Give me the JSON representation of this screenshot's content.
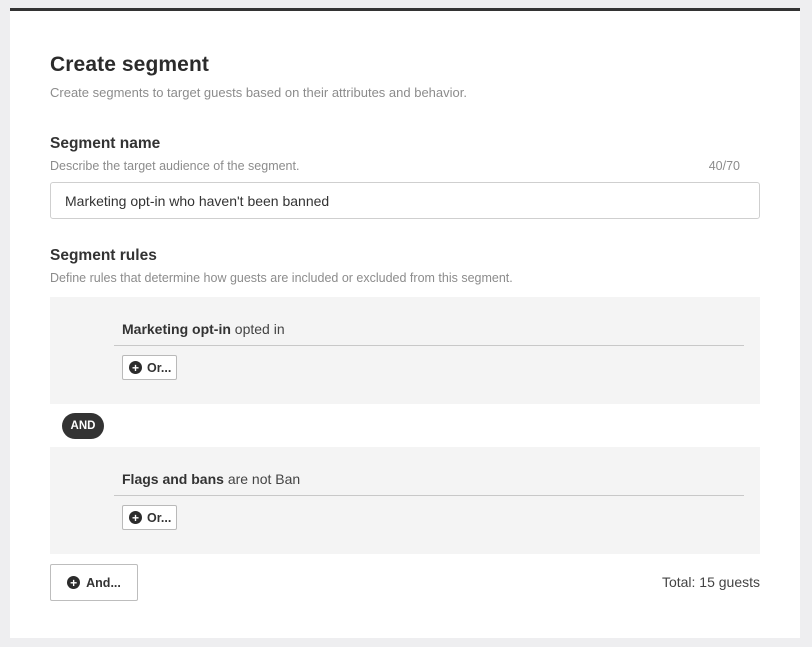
{
  "header": {
    "title": "Create segment",
    "subtitle": "Create segments to target guests based on their attributes and behavior."
  },
  "segment_name": {
    "label": "Segment name",
    "description": "Describe the target audience of the segment.",
    "counter": "40/70",
    "value": "Marketing opt-in who haven't been banned"
  },
  "segment_rules": {
    "label": "Segment rules",
    "description": "Define rules that determine how guests are included or excluded from this segment.",
    "groups": [
      {
        "attribute": "Marketing opt-in",
        "condition": "opted in",
        "or_label": "Or..."
      },
      {
        "attribute": "Flags and bans",
        "condition": "are not Ban",
        "or_label": "Or..."
      }
    ],
    "connector": "AND",
    "and_label": "And...",
    "total": "Total: 15 guests"
  },
  "icons": {
    "add": "plus-circle-icon"
  },
  "colors": {
    "accent": "#333333",
    "group_bg": "#f4f4f4",
    "muted_text": "#8c8c8c"
  }
}
